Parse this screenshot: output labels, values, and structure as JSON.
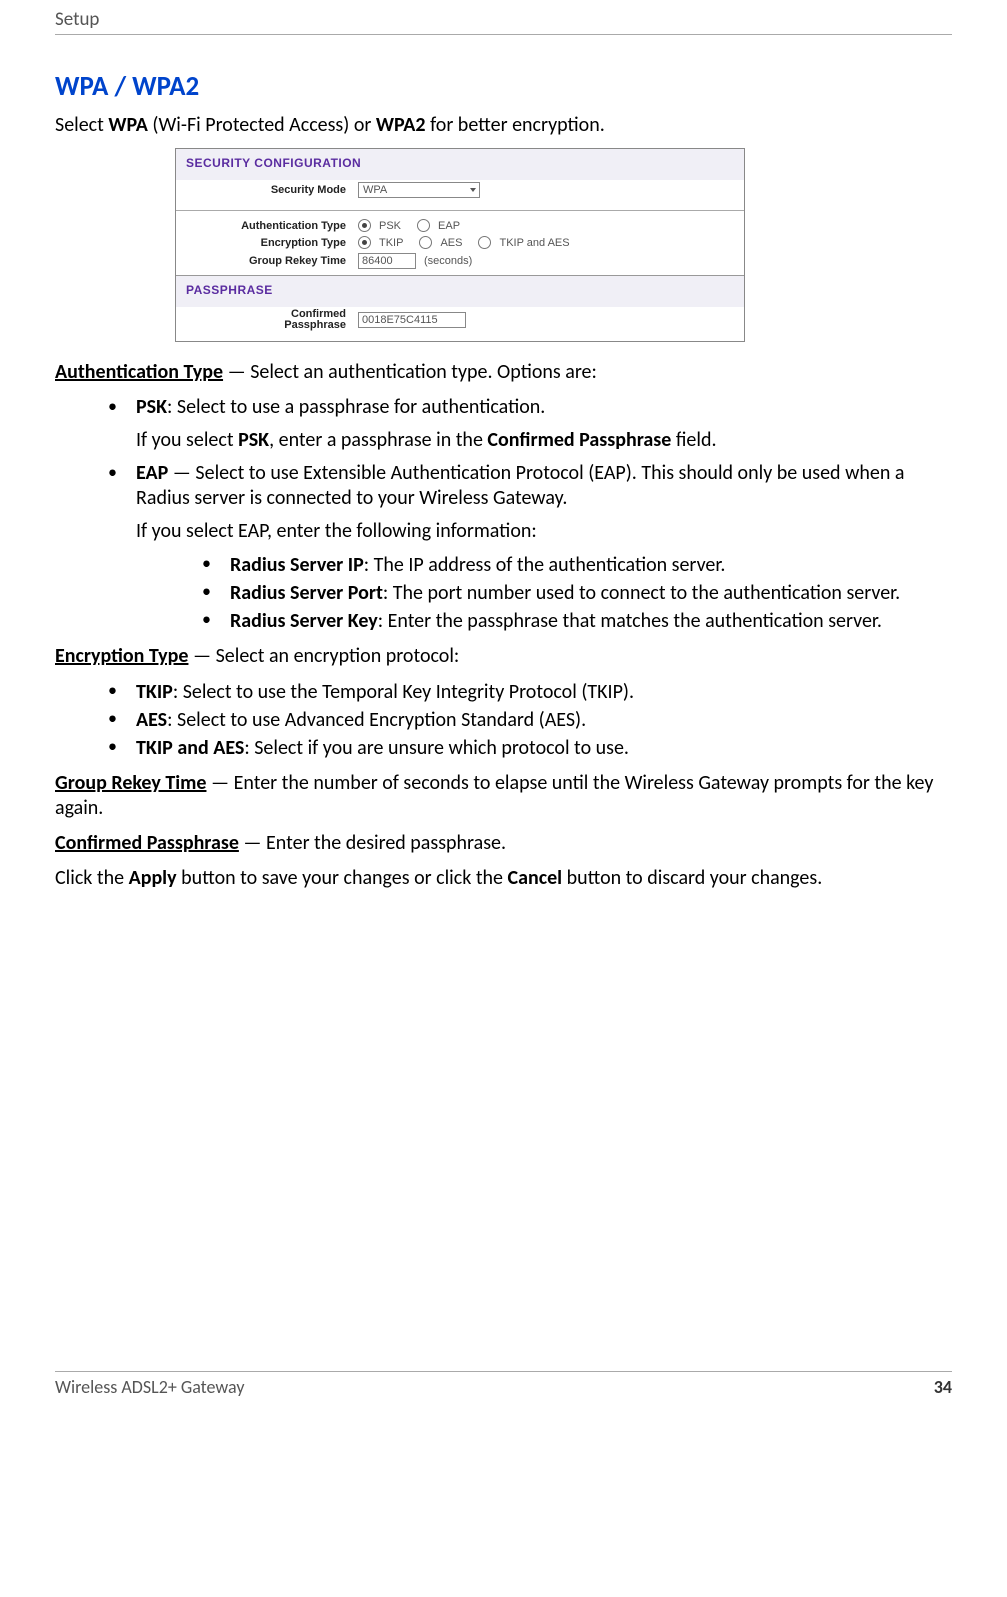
{
  "header": {
    "title": "Setup"
  },
  "heading": "WPA / WPA2",
  "intro": {
    "prefix": "Select ",
    "b1": "WPA",
    "mid1": " (Wi-Fi Protected Access) or ",
    "b2": "WPA2",
    "suffix": " for better encryption."
  },
  "screenshot": {
    "sec_config_title": "SECURITY CONFIGURATION",
    "sec_mode_label": "Security Mode",
    "sec_mode_value": "WPA",
    "auth_type_label": "Authentication Type",
    "auth_opt_psk": "PSK",
    "auth_opt_eap": "EAP",
    "enc_type_label": "Encryption Type",
    "enc_opt_tkip": "TKIP",
    "enc_opt_aes": "AES",
    "enc_opt_both": "TKIP and AES",
    "rekey_label": "Group Rekey Time",
    "rekey_value": "86400",
    "rekey_unit": "(seconds)",
    "passphrase_title": "PASSPHRASE",
    "conf_pass_label1": "Confirmed",
    "conf_pass_label2": "Passphrase",
    "conf_pass_value": "0018E75C4115"
  },
  "auth_type": {
    "lead_b": "Authentication Type",
    "lead_rest": " — Select an authentication type. Options are:"
  },
  "psk": {
    "b": "PSK",
    "rest": ": Select to use a passphrase for authentication.",
    "line2a": "If you select ",
    "line2b": "PSK",
    "line2c": ", enter a passphrase in the ",
    "line2d": "Confirmed Passphrase",
    "line2e": " field."
  },
  "eap": {
    "b": "EAP",
    "rest": " — Select to use Extensible Authentication Protocol (EAP). This should only be used when a Radius server is connected to your Wireless Gateway.",
    "line2": "If you select EAP, enter the following information:",
    "sub": [
      {
        "b": "Radius Server IP",
        "rest": ": The IP address of the authentication server."
      },
      {
        "b": "Radius Server Port",
        "rest": ": The port number used to connect to the authentication server."
      },
      {
        "b": "Radius Server Key",
        "rest": ": Enter the passphrase that matches the authentication server."
      }
    ]
  },
  "enc_type": {
    "lead_b": "Encryption Type",
    "lead_rest": " — Select an encryption protocol:",
    "items": [
      {
        "b": "TKIP",
        "rest": ": Select to use the Temporal Key Integrity Protocol (TKIP)."
      },
      {
        "b": "AES",
        "rest": ": Select to use Advanced Encryption Standard (AES)."
      },
      {
        "b": "TKIP and AES",
        "rest": ": Select if you are unsure which protocol to use."
      }
    ]
  },
  "rekey": {
    "b": "Group Rekey Time",
    "rest": " — Enter the number of seconds to elapse until the Wireless Gateway prompts for the key again."
  },
  "conf_pass": {
    "b": "Confirmed Passphrase",
    "rest": " — Enter the desired passphrase."
  },
  "apply_line": {
    "a": "Click the ",
    "b1": "Apply",
    "c": " button to save your changes or click the ",
    "b2": "Cancel",
    "d": " button to discard your changes."
  },
  "footer": {
    "left": "Wireless ADSL2+ Gateway",
    "right": "34"
  }
}
